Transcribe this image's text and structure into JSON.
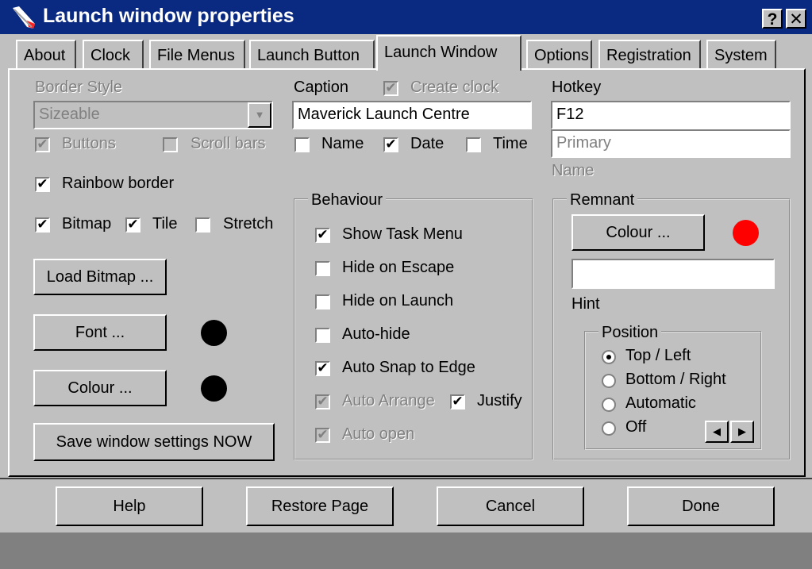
{
  "window": {
    "title": "Launch window properties",
    "help_btn": "?",
    "close_btn": "✕"
  },
  "tabs": [
    "About",
    "Clock",
    "File Menus",
    "Launch Button",
    "Launch Window",
    "Options",
    "Registration",
    "System"
  ],
  "border_style": {
    "label": "Border Style",
    "value": "Sizeable",
    "buttons_label": "Buttons",
    "scrollbars_label": "Scroll bars"
  },
  "rainbow_border": {
    "label": "Rainbow border",
    "checked": true
  },
  "bitmap": {
    "bitmap_label": "Bitmap",
    "tile_label": "Tile",
    "stretch_label": "Stretch"
  },
  "buttons": {
    "load_bitmap": "Load Bitmap ...",
    "font": "Font ...",
    "colour": "Colour ...",
    "save_settings": "Save window settings NOW"
  },
  "caption": {
    "label": "Caption",
    "create_clock_label": "Create clock",
    "value": "Maverick Launch Centre",
    "name_label": "Name",
    "date_label": "Date",
    "time_label": "Time"
  },
  "hotkey": {
    "label": "Hotkey",
    "value": "F12",
    "primary_placeholder": "Primary",
    "name_label": "Name"
  },
  "behaviour": {
    "title": "Behaviour",
    "show_task_menu": "Show Task Menu",
    "hide_on_escape": "Hide on Escape",
    "hide_on_launch": "Hide on Launch",
    "auto_hide": "Auto-hide",
    "auto_snap": "Auto Snap to Edge",
    "auto_arrange": "Auto Arrange",
    "justify": "Justify",
    "auto_open": "Auto open"
  },
  "remnant": {
    "title": "Remnant",
    "colour_button": "Colour ...",
    "hint_label": "Hint",
    "position_title": "Position",
    "options": [
      "Top / Left",
      "Bottom / Right",
      "Automatic",
      "Off"
    ],
    "selected": "Top / Left",
    "colour": "#ff0000"
  },
  "footer": {
    "help": "Help",
    "restore": "Restore Page",
    "cancel": "Cancel",
    "done": "Done"
  }
}
